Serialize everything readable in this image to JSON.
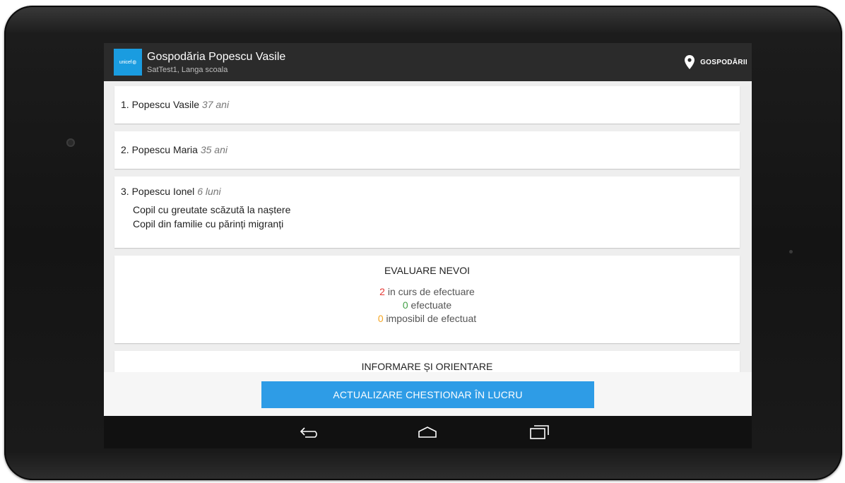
{
  "header": {
    "logo_text": "unicef",
    "title": "Gospodăria Popescu Vasile",
    "subtitle": "SatTest1, Langa scoala",
    "action_label": "GOSPODĂRII",
    "action_icon": "map-pin-icon"
  },
  "members": [
    {
      "label": "1. Popescu Vasile",
      "age": "37 ani",
      "conditions": []
    },
    {
      "label": "2. Popescu Maria",
      "age": "35 ani",
      "conditions": []
    },
    {
      "label": "3. Popescu Ionel",
      "age": "6 luni",
      "conditions": [
        "Copil cu greutate scăzută la naștere",
        "Copil din familie cu părinți migranți"
      ]
    }
  ],
  "evaluation": {
    "title": "EVALUARE NEVOI",
    "in_progress_count": "2",
    "in_progress_label": "in curs de efectuare",
    "done_count": "0",
    "done_label": "efectuate",
    "impossible_count": "0",
    "impossible_label": "imposibil de efectuat"
  },
  "information": {
    "title": "INFORMARE ȘI ORIENTARE"
  },
  "footer": {
    "button_label": "ACTUALIZARE CHESTIONAR ÎN LUCRU"
  },
  "navbar": {
    "icons": [
      "back-icon",
      "home-icon",
      "recent-apps-icon"
    ]
  },
  "colors": {
    "action_bar": "#2b2b2b",
    "primary_button": "#2e9ce6",
    "in_progress": "#e53935",
    "done": "#43a047",
    "impossible": "#f5a623",
    "logo_bg": "#1a9ce0"
  }
}
